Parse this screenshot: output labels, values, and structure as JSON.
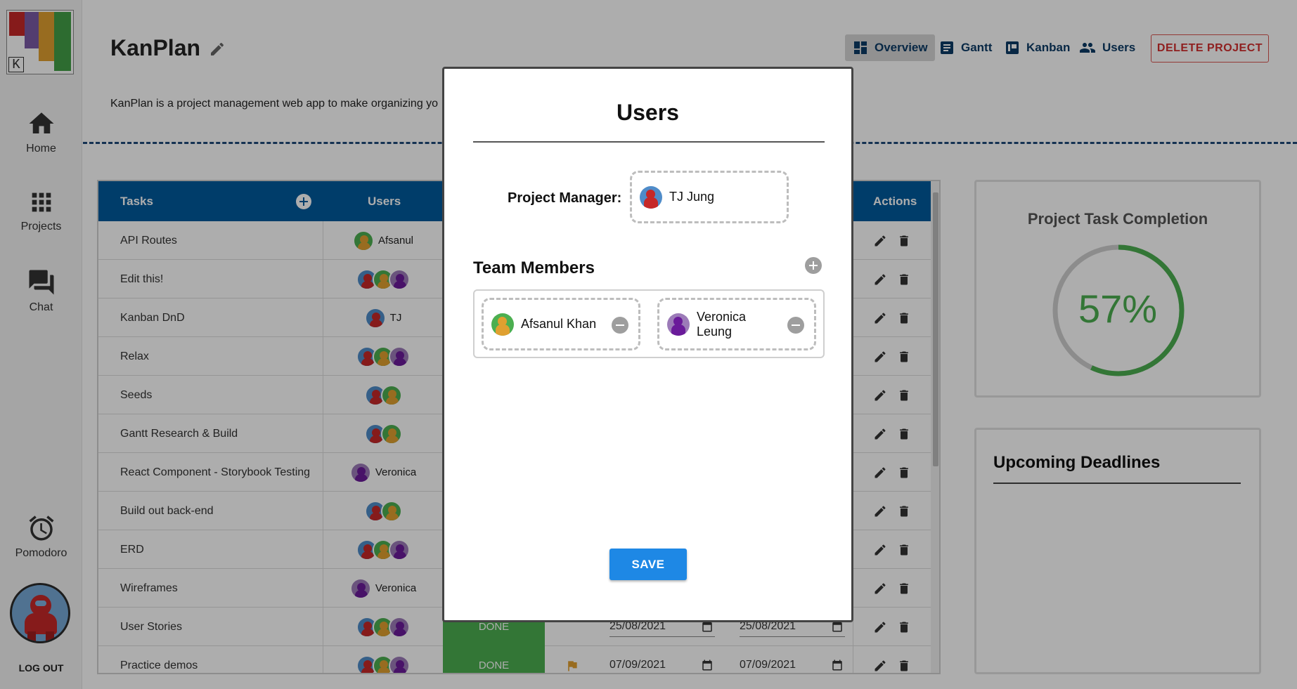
{
  "sidebar": {
    "logo_letter": "K",
    "items": [
      {
        "label": "Home",
        "icon": "home-icon"
      },
      {
        "label": "Projects",
        "icon": "grid-icon"
      },
      {
        "label": "Chat",
        "icon": "chat-icon"
      },
      {
        "label": "Pomodoro",
        "icon": "alarm-clock-icon"
      }
    ],
    "logout_label": "LOG OUT"
  },
  "header": {
    "title": "KanPlan",
    "description": "KanPlan is a project management web app to make organizing yo",
    "nav": [
      {
        "label": "Overview",
        "icon": "dashboard-icon",
        "active": true
      },
      {
        "label": "Gantt",
        "icon": "gantt-icon"
      },
      {
        "label": "Kanban",
        "icon": "kanban-icon"
      },
      {
        "label": "Users",
        "icon": "users-icon"
      }
    ],
    "delete_label": "DELETE PROJECT"
  },
  "table": {
    "headers": {
      "tasks": "Tasks",
      "users": "Users",
      "actions": "Actions"
    },
    "rows": [
      {
        "task": "API Routes",
        "avatars": [
          "green"
        ],
        "user_label": "Afsanul"
      },
      {
        "task": "Edit this!",
        "avatars": [
          "red",
          "green",
          "purple"
        ],
        "user_label": ""
      },
      {
        "task": "Kanban DnD",
        "avatars": [
          "red"
        ],
        "user_label": "TJ"
      },
      {
        "task": "Relax",
        "avatars": [
          "red",
          "green",
          "purple"
        ],
        "user_label": ""
      },
      {
        "task": "Seeds",
        "avatars": [
          "red",
          "green"
        ],
        "user_label": ""
      },
      {
        "task": "Gantt Research & Build",
        "avatars": [
          "red",
          "green"
        ],
        "user_label": ""
      },
      {
        "task": "React Component - Storybook Testing",
        "avatars": [
          "purple"
        ],
        "user_label": "Veronica"
      },
      {
        "task": "Build out back-end",
        "avatars": [
          "red",
          "green"
        ],
        "user_label": ""
      },
      {
        "task": "ERD",
        "avatars": [
          "red",
          "green",
          "purple"
        ],
        "user_label": ""
      },
      {
        "task": "Wireframes",
        "avatars": [
          "purple"
        ],
        "user_label": "Veronica"
      },
      {
        "task": "User Stories",
        "avatars": [
          "red",
          "green",
          "purple"
        ],
        "user_label": "",
        "status": "DONE",
        "start": "25/08/2021",
        "end": "25/08/2021"
      },
      {
        "task": "Practice demos",
        "avatars": [
          "red",
          "green",
          "purple"
        ],
        "user_label": "",
        "status": "DONE",
        "start": "07/09/2021",
        "end": "07/09/2021",
        "flag": true
      }
    ]
  },
  "completion": {
    "title": "Project Task Completion",
    "percent_label": "57%",
    "percent": 0.57
  },
  "deadlines": {
    "title": "Upcoming Deadlines"
  },
  "modal": {
    "title": "Users",
    "pm_label": "Project Manager:",
    "pm_name": "TJ Jung",
    "team_label": "Team Members",
    "members": [
      {
        "name": "Afsanul Khan",
        "avatar": "green"
      },
      {
        "name": "Veronica Leung",
        "avatar": "purple"
      }
    ],
    "save_label": "SAVE"
  },
  "colors": {
    "primary": "#005a9c",
    "accent": "#1e88e5",
    "success": "#4caf50",
    "danger": "#d32f2f"
  }
}
